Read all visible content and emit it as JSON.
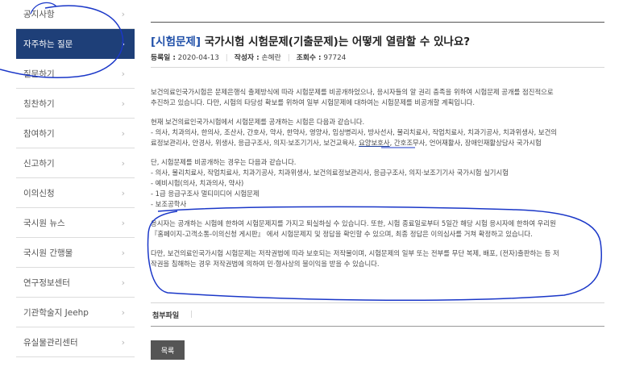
{
  "sidebar": {
    "items": [
      {
        "label": "공지사항"
      },
      {
        "label": "자주하는 질문"
      },
      {
        "label": "질문하기"
      },
      {
        "label": "칭찬하기"
      },
      {
        "label": "참여하기"
      },
      {
        "label": "신고하기"
      },
      {
        "label": "이의신청"
      },
      {
        "label": "국시원 뉴스"
      },
      {
        "label": "국시원 간행물"
      },
      {
        "label": "연구정보센터"
      },
      {
        "label": "기관학술지 Jeehp"
      },
      {
        "label": "유실물관리센터"
      }
    ],
    "chevron": "›"
  },
  "article": {
    "category": "[시험문제]",
    "title": "국가시험 시험문제(기출문제)는 어떻게 열람할 수 있나요?",
    "meta": {
      "date_label": "등록일 :",
      "date": "2020-04-13",
      "author_label": "작성자 :",
      "author": "손혜란",
      "views_label": "조회수 :",
      "views": "97724"
    },
    "p1": [
      "보건의료인국가시험은 문제은행식 출제방식에 따라 시험문제를 비공개하었으나, 응시자들의 알 권리 충족을 위하여 시험문제 공개를 점진적으로",
      "추진하고 있습니다. 다만, 시험의 타당성 확보를 위하여 일부 시험문제에 대하여는 시험문제를 비공개할 계획입니다."
    ],
    "p2_intro": "현재 보건의료인국가시험에서 시험문제를 공개하는 시험은 다음과 같습니다.",
    "p2_line1": "- 의사, 치과의사, 한의사, 조산사, 간호사, 약사, 한약사, 영양사, 임상병리사, 방사선사, 물리치료사, 작업치료사, 치과기공사, 치과위생사, 보건의",
    "p2_line2_a": "료정보관리사, 안경사, 위생사, 응급구조사, 의지·보조기기사, 보건교육사, ",
    "p2_line2_u": "요양보호사",
    "p2_line2_b": ", 간호조무사, 언어재활사, 장애인재활상담사 국가시험",
    "p3": [
      "단, 시험문제를 비공개하는 경우는 다음과 같습니다.",
      "- 의사, 물리치료사, 작업치료사, 치과기공사, 치과위생사, 보건의료정보관리사, 응급구조사, 의지·보조기기사 국가시험 실기시험",
      "- 예비시험(의사, 치과의사, 약사)",
      "- 1급 응급구조사 멀티미디어 시험문제",
      "- 보조공학사"
    ],
    "p4": [
      "응시자는 공개하는 시험에 한하여 시험문제지를 가지고 퇴실하실 수 있습니다. 또한, 시험 종료일로부터 5일간 해당 시험 응시자에 한하여 우리원",
      "『홈페이지-고객소통-이의신청 게시판』 에서 시험문제지 및 정답을 확인할 수 있으며, 최종 정답은 이의심사를 거쳐 확정하고 있습니다."
    ],
    "p5": [
      "다만, 보건의료인국가시험 시험문제는 저작권법에 따라 보호되는 저작물이며, 시험문제의 일부 또는 전부를 무단 복제, 배포, (전자)출판하는 등 저",
      "작권을 침해하는 경우 저작권법에 의하여 민·형사상의 불이익을 받을 수 있습니다."
    ],
    "attachment_label": "첨부파일",
    "list_button": "목록"
  },
  "colors": {
    "active_nav": "#1e3f78",
    "category": "#1f4fa8",
    "annotation_ink": "#1a37c8"
  }
}
